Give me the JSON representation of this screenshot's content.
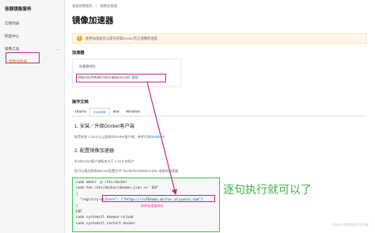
{
  "sidebar": {
    "title": "容器镜像服务",
    "items": [
      {
        "label": "实例列表"
      },
      {
        "label": "制品中心"
      }
    ],
    "group": {
      "label": "镜像工具",
      "chevron": "chevron-up-icon"
    },
    "sub_items": [
      {
        "label": "镜像加速器"
      }
    ]
  },
  "breadcrumb": [
    "容器镜像服务",
    "/",
    "镜像加速器"
  ],
  "page_title": "镜像加速器",
  "notice": {
    "icon": "warning-icon",
    "text": "使用加速器可以提升获取Docker官方镜像的速度"
  },
  "accelerator": {
    "section_title": "加速器",
    "label": "加速器地址",
    "url": "https://iu703ubn.mirror.aliyuncs.com",
    "copy_label": "复制"
  },
  "docs": {
    "section_title": "操作文档",
    "tabs": [
      "Ubuntu",
      "CentOS",
      "Mac",
      "Windows"
    ],
    "active_tab": "CentOS",
    "step1_title": "1. 安装／升级Docker客户端",
    "step1_text": "推荐安装 1.10.0 以上版本的Docker客户端，参考文档",
    "step1_link": "docker-ce",
    "step2_title": "2. 配置镜像加速器",
    "step2_text1": "针对Docker客户端版本大于 1.10.0 的用户",
    "step2_text2": "您可以通过修改daemon配置文件 /etc/docker/daemon.json 来使用加速器"
  },
  "code_lines": [
    "sudo mkdir -p /etc/docker",
    "sudo tee /etc/docker/daemon.json <<-'EOF'",
    "{",
    "  \"registry-mirrors\": [\"https://iu703ubn.mirror.aliyuncs.com\"]",
    "}",
    "EOF",
    "sudo systemctl daemon-reload",
    "sudo systemctl restart docker"
  ],
  "address_note": "你的加速器地址",
  "annotation": "逐句执行就可以了",
  "watermark": "CSDN @我是阳光马马哥",
  "colors": {
    "accent": "#ff6a00",
    "link": "#0073e6",
    "highlight_magenta": "#c0298c",
    "highlight_green": "#3ec247"
  }
}
